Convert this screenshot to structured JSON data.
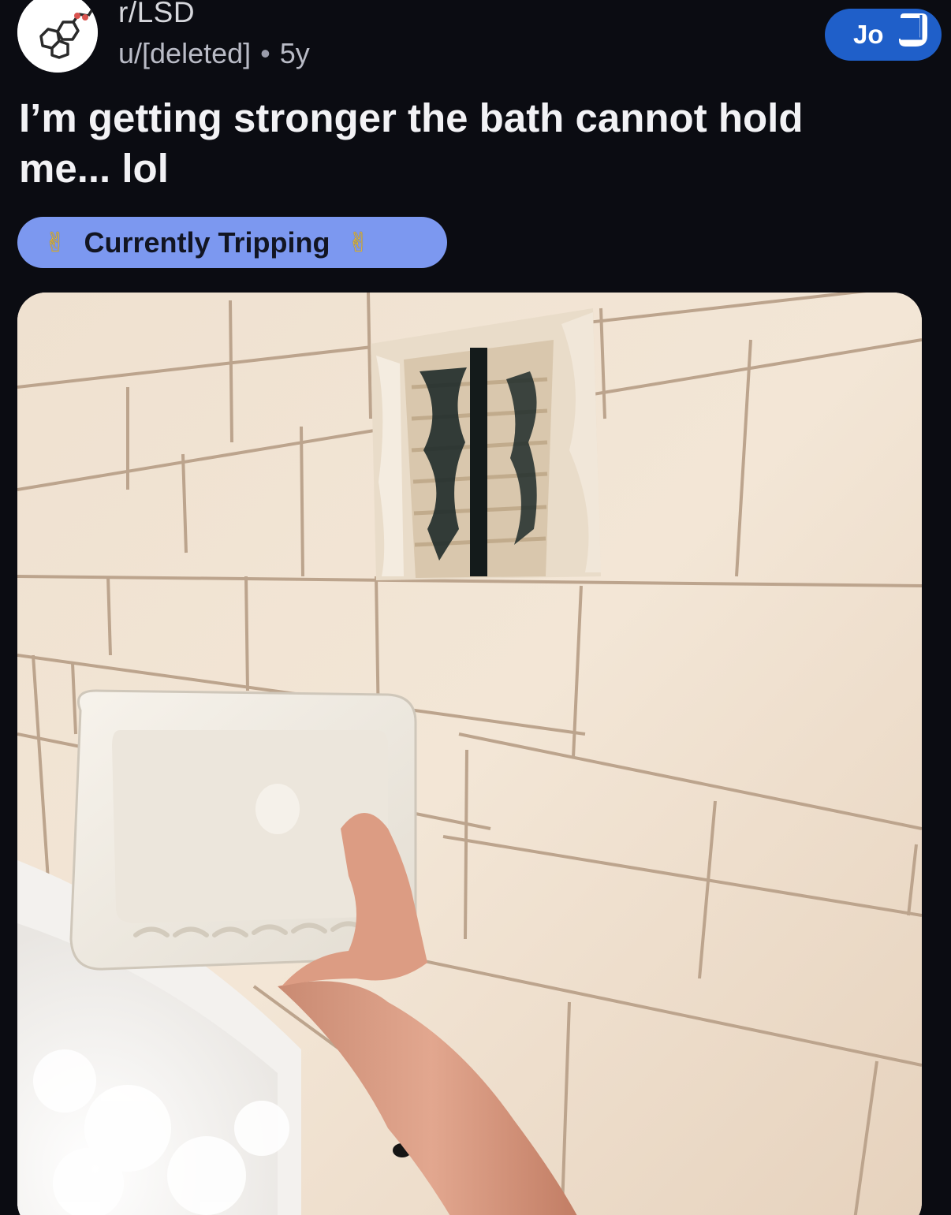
{
  "header": {
    "subreddit": "r/LSD",
    "author": "u/[deleted]",
    "separator": "•",
    "age": "5y",
    "join_label": "Jo"
  },
  "post": {
    "title": "I’m getting stronger the bath cannot hold me... lol",
    "flair": {
      "text": "Currently Tripping",
      "emoji_left": "✌",
      "emoji_right": "✌",
      "color": "#7c98f0"
    },
    "image_alt": "hand holding a ceramic soap dish pulled off a white subway-tile bathroom wall above a bubble bath"
  },
  "colors": {
    "background": "#0b0c12",
    "join_button": "#1f5fc9",
    "flair": "#7c98f0"
  },
  "icons": {
    "avatar": "lsd-molecule-icon",
    "cursor": "hand-cursor-icon"
  }
}
